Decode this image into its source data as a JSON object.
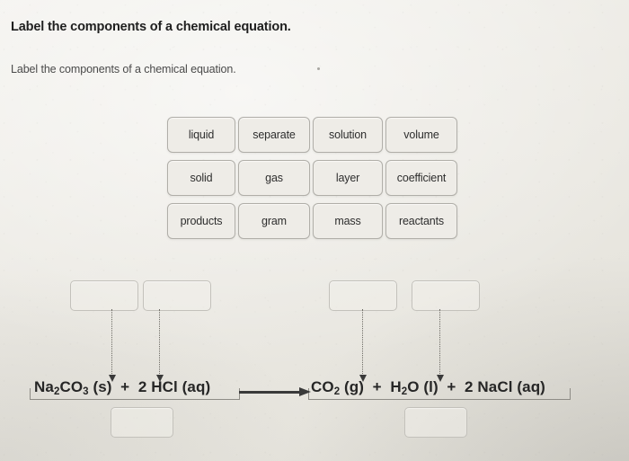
{
  "page": {
    "title": "Label the components of a chemical equation.",
    "prompt": "Label the components of a chemical equation."
  },
  "word_bank": {
    "rows": [
      [
        "liquid",
        "separate",
        "solution",
        "volume"
      ],
      [
        "solid",
        "gas",
        "layer",
        "coefficient"
      ],
      [
        "products",
        "gram",
        "mass",
        "reactants"
      ]
    ],
    "tiles": [
      "liquid",
      "separate",
      "solution",
      "volume",
      "solid",
      "gas",
      "layer",
      "coefficient",
      "products",
      "gram",
      "mass",
      "reactants"
    ]
  },
  "drop_boxes": [
    {
      "id": "drop-box-1",
      "value": "",
      "target": "(s)"
    },
    {
      "id": "drop-box-2",
      "value": "",
      "target": "(aq)"
    },
    {
      "id": "drop-box-3",
      "value": "",
      "target": "(g)"
    },
    {
      "id": "drop-box-4",
      "value": "",
      "target": "(l)"
    },
    {
      "id": "drop-box-5",
      "value": "",
      "target": "reactants-group"
    },
    {
      "id": "drop-box-6",
      "value": "",
      "target": "products-group"
    }
  ],
  "equation": {
    "reactants_html": "Na<sub>2</sub>CO<sub>3</sub> (s)&nbsp; +&nbsp; 2 HCl (aq)",
    "products_html": "CO<sub>2</sub> (g)&nbsp; +&nbsp; H<sub>2</sub>O (l)&nbsp; +&nbsp; 2 NaCl (aq)",
    "reactants_text": "Na2CO3 (s) + 2 HCl (aq)",
    "products_text": "CO2 (g) + H2O (l) + 2 NaCl (aq)",
    "arrow": "→"
  },
  "colors": {
    "page_background": "#eceae4",
    "tile_background": "#eeece7",
    "tile_border": "#b0aea8",
    "drop_box_border": "#c3c1bb",
    "text": "#2b2b2b",
    "equation_text": "#262626",
    "connector": "#6f6d67",
    "arrow": "#3a3a3a"
  }
}
